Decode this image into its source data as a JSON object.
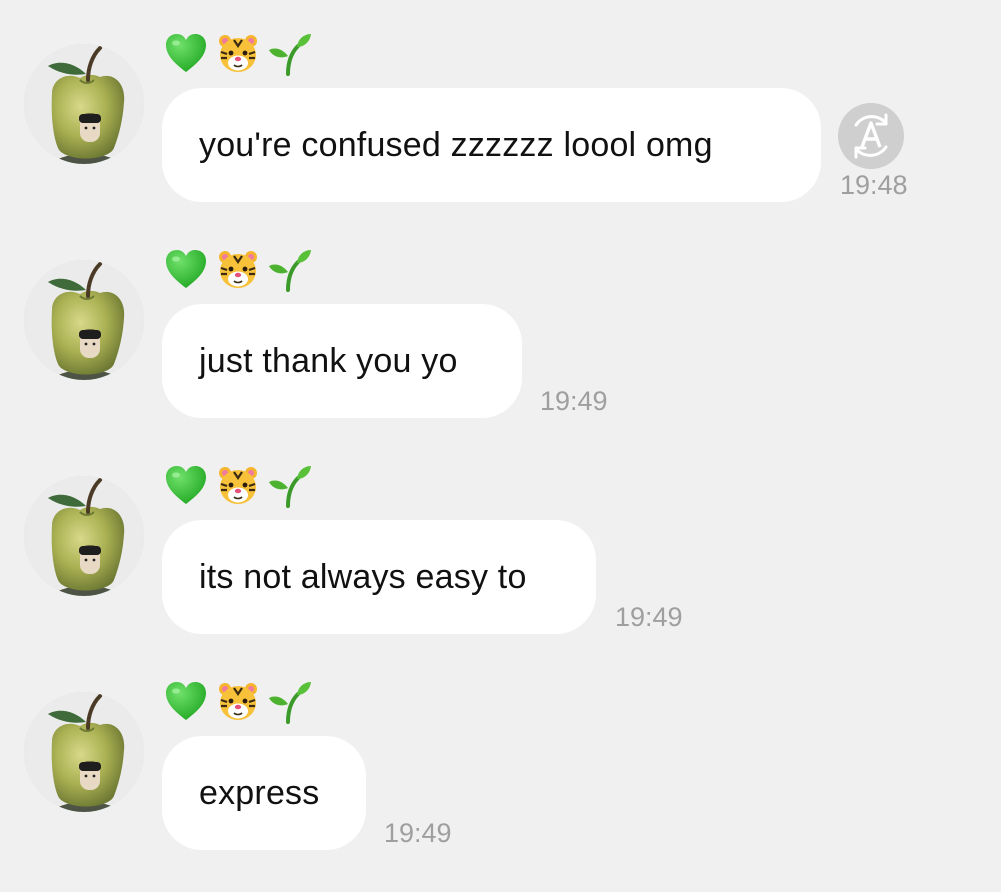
{
  "sender": {
    "name_icons": [
      "green-heart-icon",
      "tiger-face-icon",
      "seedling-icon"
    ]
  },
  "messages": [
    {
      "text": "you're confused zzzzzz loool omg",
      "time": "19:48",
      "translate_icon": "translate-icon"
    },
    {
      "text": "just thank you yo",
      "time": "19:49"
    },
    {
      "text": "its not always easy to",
      "time": "19:49"
    },
    {
      "text": "express",
      "time": "19:49"
    }
  ],
  "colors": {
    "background": "#f0f0f0",
    "bubble": "#ffffff",
    "text": "#111111",
    "timestamp": "#9f9f9f",
    "heart": "#3cc43a"
  }
}
